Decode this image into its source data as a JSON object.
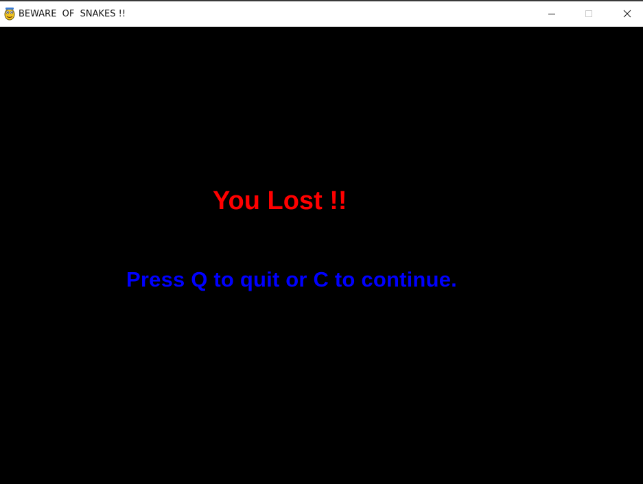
{
  "window": {
    "title": "BEWARE  OF  SNAKES !!",
    "icon": "pygame-snake-icon",
    "controls": {
      "minimize": "minimize-icon",
      "maximize": "maximize-icon",
      "close": "close-icon"
    }
  },
  "game": {
    "background_color": "#000000",
    "message": {
      "text": "You Lost !!",
      "color": "#ff0000"
    },
    "prompt": {
      "text": "Press Q to quit or C to continue.",
      "color": "#0000ff"
    }
  }
}
